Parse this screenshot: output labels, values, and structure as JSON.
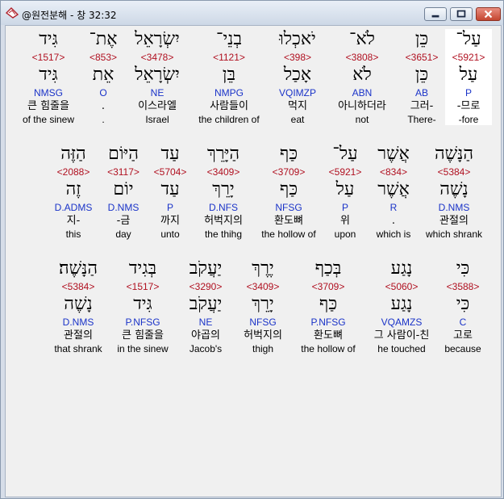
{
  "window": {
    "title": "@원전분해 - 창 32:32"
  },
  "verses": [
    {
      "words": [
        {
          "heb": "עַל־",
          "num": "<5921>",
          "lemma": "עַל",
          "code": "P",
          "ko": "-므로",
          "en": "-fore",
          "selected": true
        },
        {
          "heb": "כֵּן",
          "num": "<3651>",
          "lemma": "כֵּן",
          "code": "AB",
          "ko": "그러-",
          "en": "There-"
        },
        {
          "heb": "לֹא־",
          "num": "<3808>",
          "lemma": "לֹא",
          "code": "ABN",
          "ko": "아니하더라",
          "en": "not"
        },
        {
          "heb": "יֹאכְלוּ",
          "num": "<398>",
          "lemma": "אָכַל",
          "code": "VQIMZP",
          "ko": "먹지",
          "en": "eat"
        },
        {
          "heb": "בְנֵי־",
          "num": "<1121>",
          "lemma": "בֵּן",
          "code": "NMPG",
          "ko": "사람들이",
          "en": "the children of"
        },
        {
          "heb": "יִשְׂרָאֵל",
          "num": "<3478>",
          "lemma": "יִשְׂרָאֵל",
          "code": "NE",
          "ko": "이스라엘",
          "en": "Israel"
        },
        {
          "heb": "אֶת־",
          "num": "<853>",
          "lemma": "אֵת",
          "code": "O",
          "ko": ".",
          "en": "."
        },
        {
          "heb": "גִּיד",
          "num": "<1517>",
          "lemma": "גִּיד",
          "code": "NMSG",
          "ko": "큰 힘줄을",
          "en": "of the sinew"
        }
      ]
    },
    {
      "words": [
        {
          "heb": "הַנָּשֶׁה",
          "num": "<5384>",
          "lemma": "נָשֶׁה",
          "code": "D.NMS",
          "ko": "관절의",
          "en": "which shrank"
        },
        {
          "heb": "אֲשֶׁר",
          "num": "<834>",
          "lemma": "אֲשֶׁר",
          "code": "R",
          "ko": ".",
          "en": "which is"
        },
        {
          "heb": "עַל־",
          "num": "<5921>",
          "lemma": "עַל",
          "code": "P",
          "ko": "위",
          "en": "upon"
        },
        {
          "heb": "כַּף",
          "num": "<3709>",
          "lemma": "כַּף",
          "code": "NFSG",
          "ko": "환도뼈",
          "en": "the hollow of"
        },
        {
          "heb": "הַיָּרֵךְ",
          "num": "<3409>",
          "lemma": "יָרֵךְ",
          "code": "D.NFS",
          "ko": "허벅지의",
          "en": "the thihg"
        },
        {
          "heb": "עַד",
          "num": "<5704>",
          "lemma": "עַד",
          "code": "P",
          "ko": "까지",
          "en": "unto"
        },
        {
          "heb": "הַיּוֹם",
          "num": "<3117>",
          "lemma": "יוֹם",
          "code": "D.NMS",
          "ko": "-금",
          "en": "day"
        },
        {
          "heb": "הַזֶּה",
          "num": "<2088>",
          "lemma": "זֶה",
          "code": "D.ADMS",
          "ko": "지-",
          "en": "this"
        }
      ]
    },
    {
      "words": [
        {
          "heb": "כִּי",
          "num": "<3588>",
          "lemma": "כִּי",
          "code": "C",
          "ko": "고로",
          "en": "because"
        },
        {
          "heb": "נָגַע",
          "num": "<5060>",
          "lemma": "נָגַע",
          "code": "VQAMZS",
          "ko": "그 사람이-친",
          "en": "he touched"
        },
        {
          "heb": "בְּכַף",
          "num": "<3709>",
          "lemma": "כַּף",
          "code": "P.NFSG",
          "ko": "환도뼈",
          "en": "the hollow of"
        },
        {
          "heb": "יֶרֶךְ",
          "num": "<3409>",
          "lemma": "יָרֵךְ",
          "code": "NFSG",
          "ko": "허벅지의",
          "en": "thigh"
        },
        {
          "heb": "יַעֲקֹב",
          "num": "<3290>",
          "lemma": "יַעֲקֹב",
          "code": "NE",
          "ko": "야곱의",
          "en": "Jacob's"
        },
        {
          "heb": "בְּגִיד",
          "num": "<1517>",
          "lemma": "גִּיד",
          "code": "P.NFSG",
          "ko": "큰 힘줄을",
          "en": "in the sinew"
        },
        {
          "heb": "הַנָּשֶׁה׃",
          "num": "<5384>",
          "lemma": "נָשֶׁה",
          "code": "D.NMS",
          "ko": "관절의",
          "en": "that shrank"
        }
      ]
    }
  ]
}
